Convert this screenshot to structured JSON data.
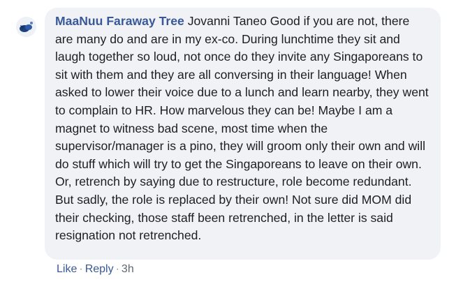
{
  "comment": {
    "author": "MaaNuu Faraway Tree",
    "mention": "Jovanni Taneo",
    "body": "Good if you are not, there are many do and are in my ex-co. During lunchtime they sit and laugh together so loud, not once do they invite any Singaporeans to sit with them and they are all conversing in their language! When asked to lower their voice due to a lunch and learn nearby, they went to complain to HR. How marvelous they can be! Maybe I am a magnet to witness bad scene, most time when the supervisor/manager is a pino, they will groom only their own and will do stuff which will try to get the Singaporeans to leave on their own. Or, retrench by saying due to restructure, role become redundant. But sadly, the role is replaced by their own! Not sure did MOM did their checking, those staff been retrenched, in the letter is said resignation not retrenched."
  },
  "actions": {
    "like_label": "Like",
    "separator": "·",
    "reply_label": "Reply",
    "timestamp": "3h"
  },
  "avatar": {
    "icon": "avatar-image"
  },
  "colors": {
    "author": "#385898",
    "bubble_background": "#f0f2f5",
    "text": "#1c1e21",
    "meta": "#606770"
  }
}
